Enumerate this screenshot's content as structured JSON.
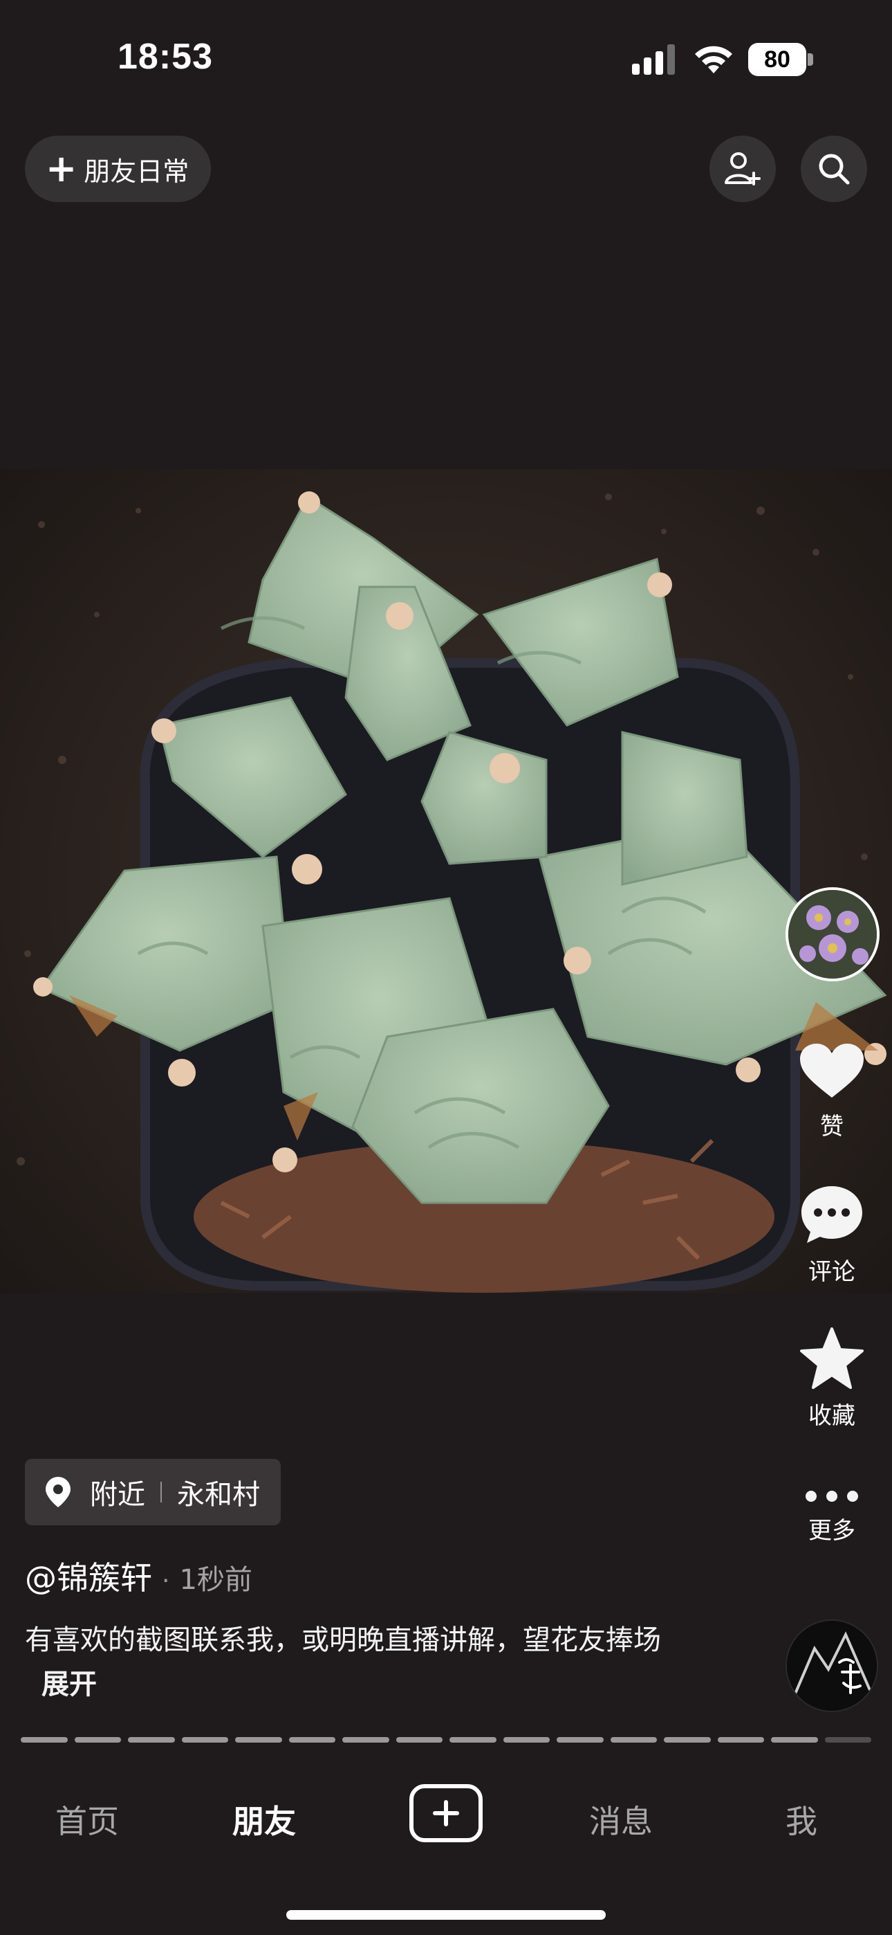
{
  "status_bar": {
    "time": "18:53",
    "battery": "80"
  },
  "top_bar": {
    "friends_daily_label": "朋友日常",
    "add_friend_icon": "add-person-icon",
    "search_icon": "search-icon"
  },
  "post": {
    "location_prefix": "附近",
    "location_name": "永和村",
    "author": "@锦簇轩",
    "time_ago": "1秒前",
    "caption": "有喜欢的截图联系我，或明晚直播讲解，望花友捧场",
    "expand_label": "展开"
  },
  "actions": {
    "like_label": "赞",
    "comment_label": "评论",
    "favorite_label": "收藏",
    "more_label": "更多"
  },
  "progress": {
    "segments_total": 16,
    "segments_viewed": 15
  },
  "bottom_nav": {
    "home": "首页",
    "friends": "朋友",
    "messages": "消息",
    "me": "我",
    "active": "friends"
  },
  "colors": {
    "background": "#1f1b1d",
    "plant": "#9fb8a0"
  }
}
